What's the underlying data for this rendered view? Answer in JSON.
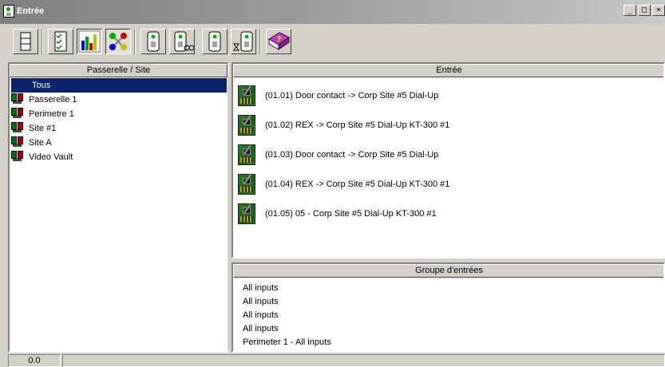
{
  "window": {
    "title": "Entrée",
    "buttons": {
      "minimize": "_",
      "maximize": "□",
      "close": "×"
    }
  },
  "toolbar": {
    "buttons": [
      {
        "name": "list-view-icon"
      },
      {
        "name": "check-list-icon"
      },
      {
        "name": "chart-icon"
      },
      {
        "name": "connections-icon"
      },
      {
        "name": "panel-icon"
      },
      {
        "name": "panel-link-icon"
      },
      {
        "name": "panel-single-icon"
      },
      {
        "name": "panel-time-icon"
      },
      {
        "name": "help-book-icon"
      }
    ]
  },
  "left_panel": {
    "header": "Passerelle / Site",
    "items": [
      {
        "label": "Tous",
        "selected": true
      },
      {
        "label": "Passerelle 1"
      },
      {
        "label": "Perimetre 1"
      },
      {
        "label": "Site #1"
      },
      {
        "label": "Site A"
      },
      {
        "label": "Video Vault"
      }
    ]
  },
  "inputs_panel": {
    "header": "Entrée",
    "items": [
      {
        "label": "(01.01) Door contact -> Corp Site #5 Dial-Up"
      },
      {
        "label": "(01.02) REX -> Corp Site #5 Dial-Up KT-300 #1"
      },
      {
        "label": "(01.03) Door contact -> Corp Site #5 Dial-Up"
      },
      {
        "label": "(01.04) REX -> Corp Site #5 Dial-Up KT-300 #1"
      },
      {
        "label": "(01.05) 05 - Corp Site #5 Dial-Up KT-300 #1"
      }
    ]
  },
  "groups_panel": {
    "header": "Groupe d'entrées",
    "items": [
      {
        "label": "All inputs"
      },
      {
        "label": "All inputs"
      },
      {
        "label": "All inputs"
      },
      {
        "label": "All inputs"
      },
      {
        "label": "Perimeter 1 - All inputs"
      }
    ]
  },
  "status": {
    "left": "0.0",
    "right": ""
  },
  "colors": {
    "selection": "#0a246a",
    "face": "#d4d0c8",
    "title_gradient_start": "#808080"
  }
}
